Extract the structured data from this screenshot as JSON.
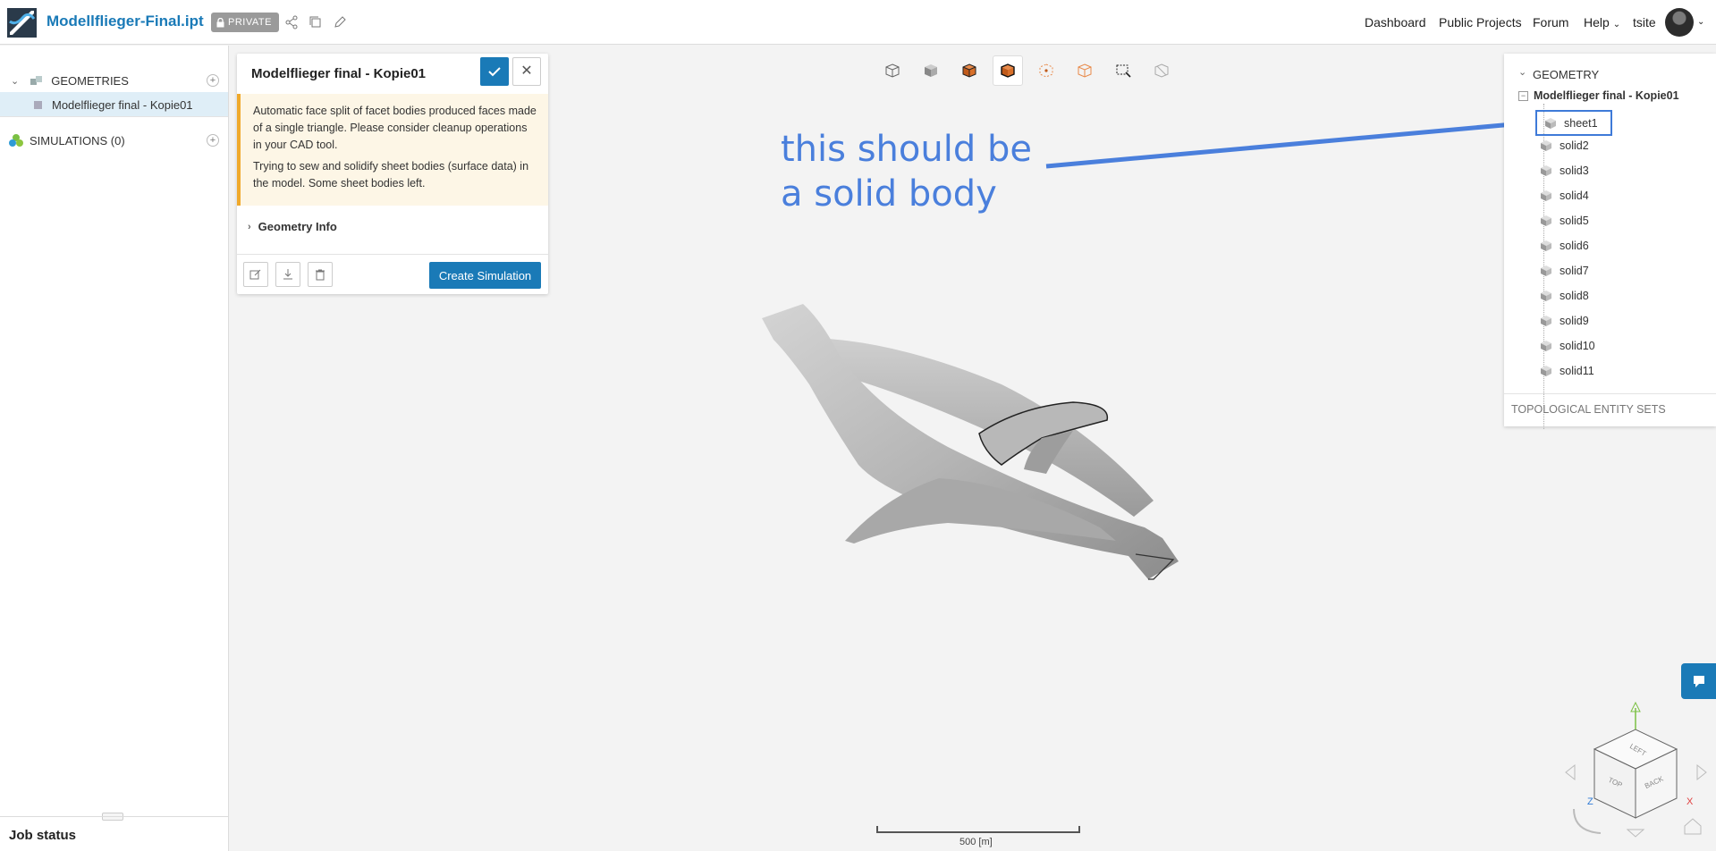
{
  "header": {
    "project_title": "Modellflieger-Final.ipt",
    "privacy_badge": "PRIVATE",
    "nav": [
      "Dashboard",
      "Public Projects",
      "Forum",
      "Help"
    ],
    "username": "tsite"
  },
  "sidebar": {
    "geometries_label": "GEOMETRIES",
    "geometry_item": "Modelflieger final - Kopie01",
    "simulations_label": "SIMULATIONS (0)",
    "job_status": "Job status"
  },
  "card": {
    "title": "Modelflieger final - Kopie01",
    "warning_1": "Automatic face split of facet bodies produced faces made of a single triangle. Please consider cleanup operations in your CAD tool.",
    "warning_2": "Trying to sew and solidify sheet bodies (surface data) in the model. Some sheet bodies left.",
    "geometry_info": "Geometry Info",
    "create_simulation": "Create Simulation"
  },
  "viewport": {
    "annotation_line_1": "this should be",
    "annotation_line_2": "a solid body",
    "scale_label": "500 [m]",
    "cube_labels": [
      "LEFT",
      "TOP",
      "BACK"
    ],
    "axes": [
      "Z",
      "X"
    ]
  },
  "geometry_tree": {
    "title": "GEOMETRY",
    "root": "Modelflieger final - Kopie01",
    "bodies": [
      "sheet1",
      "solid2",
      "solid3",
      "solid4",
      "solid5",
      "solid6",
      "solid7",
      "solid8",
      "solid9",
      "solid10",
      "solid11"
    ],
    "topological_sets": "TOPOLOGICAL ENTITY SETS"
  },
  "colors": {
    "accent": "#1a7ab7",
    "warning_border": "#f0a92b",
    "annotation": "#4a7fdc"
  }
}
